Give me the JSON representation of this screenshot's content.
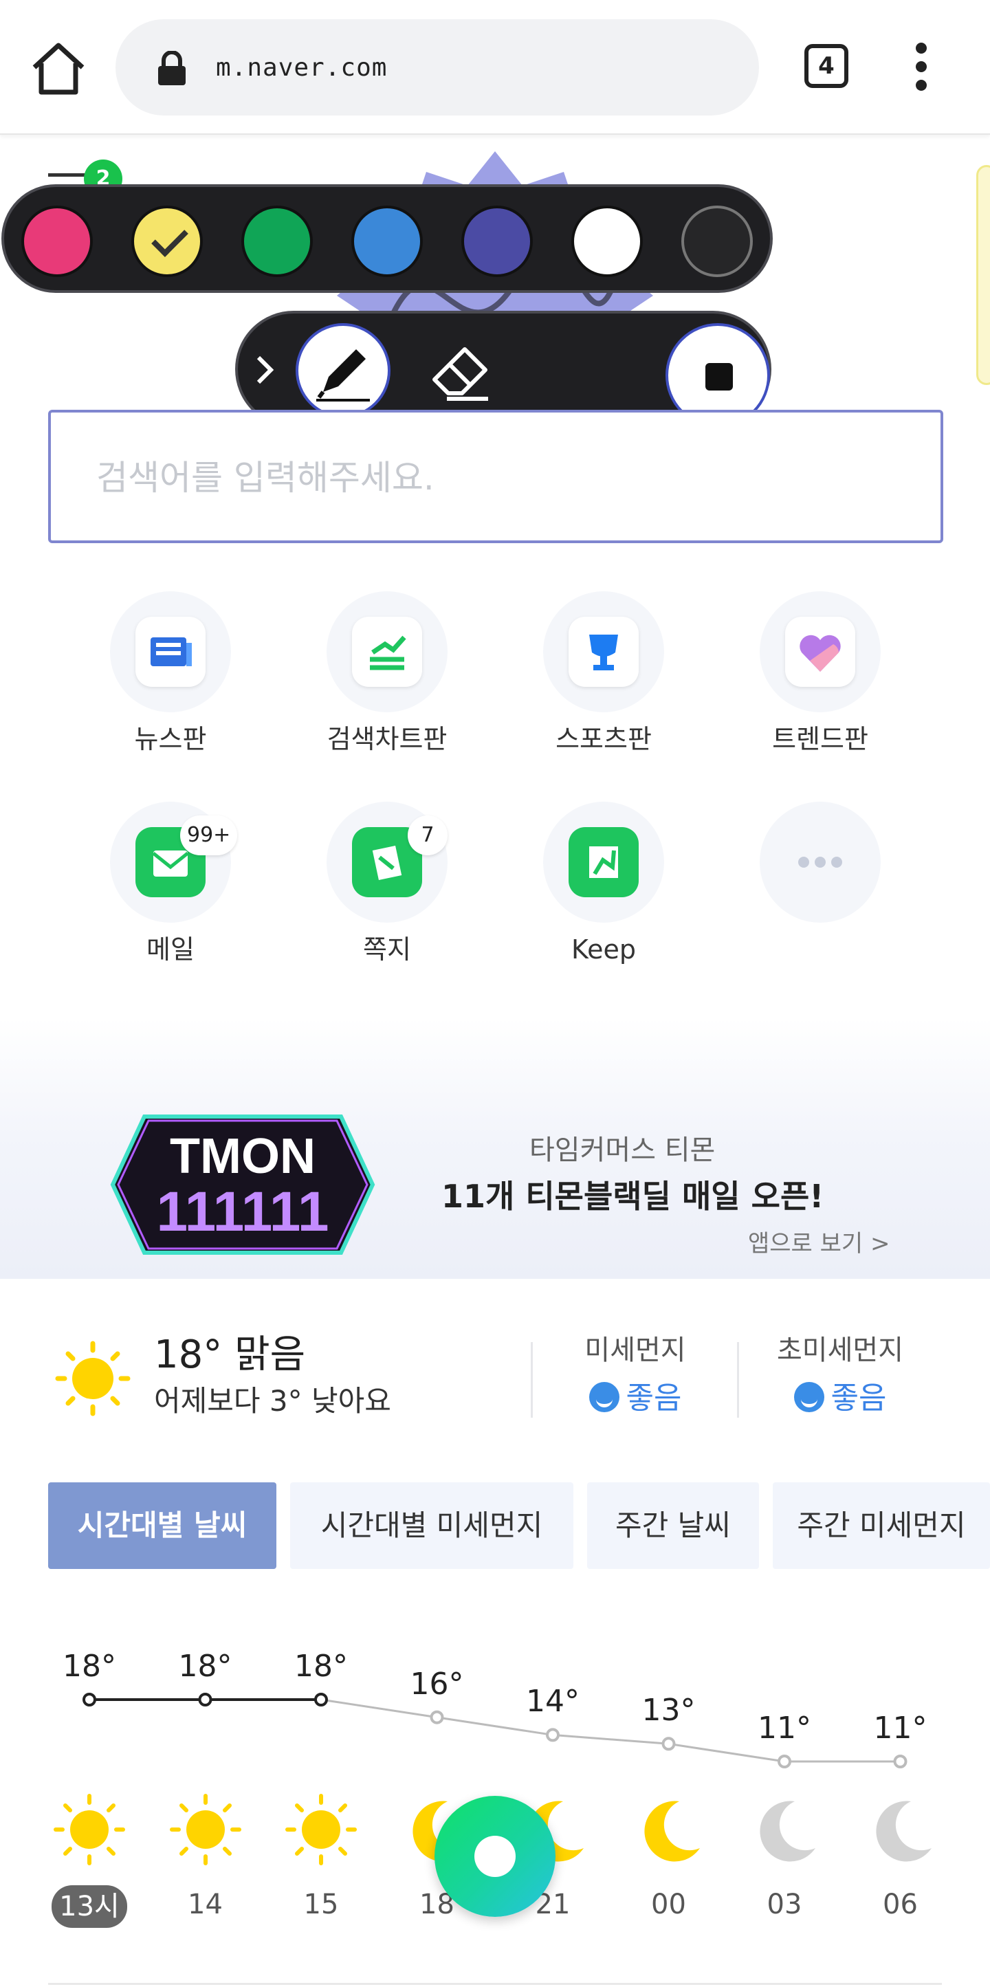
{
  "browser": {
    "url": "m.naver.com",
    "tab_count": "4",
    "icons": {
      "home": "home-icon",
      "lock": "lock-icon",
      "menu": "kebab-menu-icon"
    }
  },
  "header": {
    "menu_badge": "2"
  },
  "palette": {
    "colors": [
      "#e83a78",
      "#f5e46a",
      "#10a556",
      "#3b88d8",
      "#4b4ba4",
      "#ffffff",
      "#262628"
    ],
    "selected_index": 1
  },
  "tools": {
    "items": [
      "expand-chevron-icon",
      "pen-icon",
      "eraser-icon",
      "stop-icon"
    ],
    "active": "pen"
  },
  "search": {
    "placeholder": "검색어를 입력해주세요."
  },
  "shortcuts": [
    {
      "label": "뉴스판",
      "icon": "news-icon"
    },
    {
      "label": "검색차트판",
      "icon": "search-chart-icon"
    },
    {
      "label": "스포츠판",
      "icon": "trophy-icon"
    },
    {
      "label": "트렌드판",
      "icon": "heart-icon"
    },
    {
      "label": "메일",
      "icon": "mail-icon",
      "badge": "99+"
    },
    {
      "label": "쪽지",
      "icon": "note-icon",
      "badge": "7"
    },
    {
      "label": "Keep",
      "icon": "keep-icon"
    },
    {
      "label": "",
      "icon": "more-icon"
    }
  ],
  "ad": {
    "logo_line1": "TMON",
    "logo_line2": "111111",
    "subtitle": "타임커머스 티몬",
    "title": "11개 티몬블랙딜 매일 오픈!",
    "link": "앱으로 보기 >"
  },
  "weather": {
    "current_temp": "18°",
    "condition": "맑음",
    "compare": "어제보다 3° 낮아요",
    "dust": {
      "label": "미세먼지",
      "value": "좋음"
    },
    "fine_dust": {
      "label": "초미세먼지",
      "value": "좋음"
    },
    "tabs": [
      "시간대별 날씨",
      "시간대별 미세먼지",
      "주간 날씨",
      "주간 미세먼지"
    ],
    "active_tab": 0
  },
  "chart_data": {
    "type": "line",
    "categories": [
      "13시",
      "14",
      "15",
      "18",
      "21",
      "00",
      "03",
      "06"
    ],
    "values": [
      18,
      18,
      18,
      16,
      14,
      13,
      11,
      11
    ],
    "temp_labels": [
      "18°",
      "18°",
      "18°",
      "16°",
      "14°",
      "13°",
      "11°",
      "11°"
    ],
    "icons": [
      "sun-icon",
      "sun-icon",
      "sun-icon",
      "moon-icon",
      "moon-icon",
      "moon-icon",
      "moon-gray-icon",
      "moon-gray-icon"
    ],
    "past_count": 3,
    "ylim": [
      11,
      18
    ]
  }
}
